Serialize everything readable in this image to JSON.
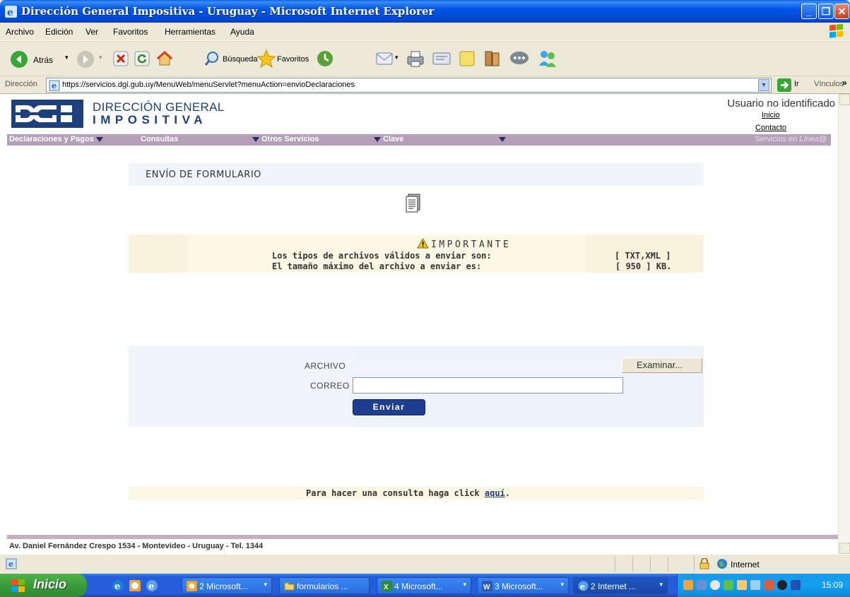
{
  "window": {
    "title": "Dirección General Impositiva - Uruguay - Microsoft Internet Explorer"
  },
  "menubar": {
    "items": [
      "Archivo",
      "Edición",
      "Ver",
      "Favoritos",
      "Herramientas",
      "Ayuda"
    ]
  },
  "toolbar": {
    "back_label": "Atrás",
    "search_label": "Búsqueda",
    "favorites_label": "Favoritos"
  },
  "addressbar": {
    "label": "Dirección",
    "url": "https://servicios.dgi.gub.uy/MenuWeb/menuServlet?menuAction=envioDeclaraciones",
    "go_label": "Ir",
    "links_label": "Vínculos"
  },
  "header": {
    "logo_text": "DGI",
    "org_line1": "DIRECCIÓN GENERAL",
    "org_line2": "IMPOSITIVA",
    "user_status": "Usuario no identificado",
    "link_inicio": "Inicio",
    "link_contacto": "Contacto"
  },
  "nav": {
    "items": [
      "Declaraciones y Pagos",
      "Consultas",
      "Otros Servicios",
      "Clave"
    ],
    "brand_prefix": "Servicios ",
    "brand_suffix": "en Línea",
    "brand_at": "@"
  },
  "page": {
    "section_title": "ENVÍO DE FORMULARIO",
    "important_title": "IMPORTANTE",
    "rule1_label": "Los tipos de archivos válidos a enviar son:",
    "rule1_value": "[ TXT,XML ]",
    "rule2_label": "El tamaño máximo del archivo a enviar es:",
    "rule2_value": "[ 950 ] KB.",
    "archivo_label": "ARCHIVO",
    "browse_label": "Examinar...",
    "correo_label": "CORREO",
    "correo_value": "",
    "send_label": "Enviar",
    "consult_prefix": "Para hacer una consulta haga click ",
    "consult_link": "aquí",
    "consult_suffix": "."
  },
  "footer": {
    "address": "Av. Daniel Fernández Crespo 1534 - Montevideo - Uruguay - Tel. 1344"
  },
  "statusbar": {
    "zone": "Internet"
  },
  "taskbar": {
    "start_label": "Inicio",
    "tasks": [
      "2 Microsoft...",
      "formularios ...",
      "4 Microsoft...",
      "3 Microsoft...",
      "2 Internet ..."
    ],
    "clock": "15:09"
  },
  "colors": {
    "xp_blue": "#0055e5",
    "nav_purple": "#b59fb8",
    "dgi_blue": "#1d3f7c",
    "send_button": "#1f3f8e",
    "important_bg": "#fdf7e6",
    "form_bg": "#f1f5fa"
  }
}
